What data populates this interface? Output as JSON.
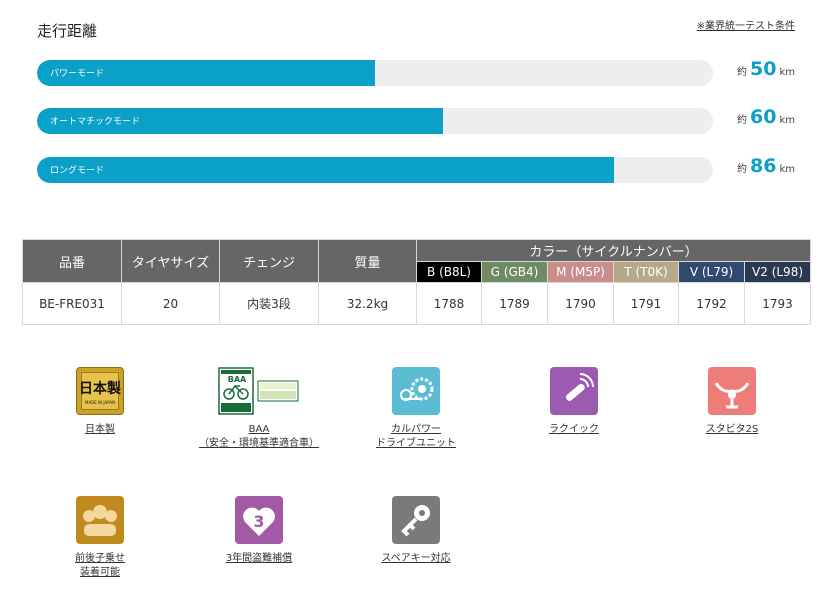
{
  "header": {
    "title": "走行距離",
    "note": "※業界統一テスト条件"
  },
  "ranges": [
    {
      "label": "パワーモード",
      "prefix": "約",
      "value": "50",
      "unit": "km",
      "fraction": 0.5
    },
    {
      "label": "オートマチックモード",
      "prefix": "約",
      "value": "60",
      "unit": "km",
      "fraction": 0.6
    },
    {
      "label": "ロングモード",
      "prefix": "約",
      "value": "86",
      "unit": "km",
      "fraction": 0.854
    }
  ],
  "spec_table": {
    "headers": {
      "model": "品番",
      "tire": "タイヤサイズ",
      "gear": "チェンジ",
      "weight": "質量",
      "color_group": "カラー（サイクルナンバー）"
    },
    "colors": [
      {
        "label": "B (B8L)",
        "number": "1788",
        "bg": "#000000"
      },
      {
        "label": "G (GB4)",
        "number": "1789",
        "bg": "#6e8c62"
      },
      {
        "label": "M (M5P)",
        "number": "1790",
        "bg": "#c98e8c"
      },
      {
        "label": "T (T0K)",
        "number": "1791",
        "bg": "#b8a88a"
      },
      {
        "label": "V (L79)",
        "number": "1792",
        "bg": "#2f4a6e"
      },
      {
        "label": "V2 (L98)",
        "number": "1793",
        "bg": "#2a3850"
      }
    ],
    "row": {
      "model": "BE-FRE031",
      "tire": "20",
      "gear": "内装3段",
      "weight": "32.2kg"
    }
  },
  "features": [
    {
      "icon": "made-in-japan-icon",
      "label": "日本製",
      "icon_text": "日本製",
      "icon_subtext": "MADE IN JAPAN"
    },
    {
      "icon": "baa-icon",
      "label": "BAA",
      "label2": "（安全・環境基準適合車）",
      "icon_text": "BAA"
    },
    {
      "icon": "drive-unit-icon",
      "label": "カルパワー",
      "label2": "ドライブユニット"
    },
    {
      "icon": "rakuick-key-icon",
      "label": "ラクイック"
    },
    {
      "icon": "stabista-handle-icon",
      "label": "スタビタ2S"
    },
    {
      "icon": "child-seat-icon",
      "label": "前後子乗せ",
      "label2": "装着可能"
    },
    {
      "icon": "theft-heart-icon",
      "label": "3年間盗難補償",
      "icon_text": "3"
    },
    {
      "icon": "spare-key-icon",
      "label": "スペアキー対応"
    }
  ],
  "colors": {
    "accent": "#0aa0c8",
    "track": "#eeeeee",
    "table_header": "#666666"
  }
}
